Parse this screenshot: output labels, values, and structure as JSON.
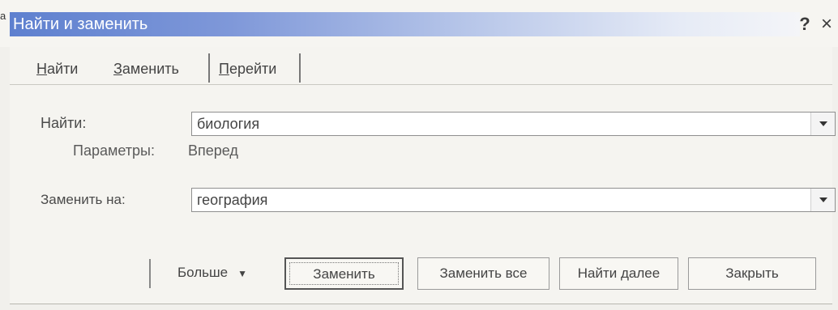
{
  "window": {
    "title": "Найти и заменить",
    "corner_mark": "a",
    "help_glyph": "?",
    "close_glyph": "×"
  },
  "tabs": [
    {
      "label_pre": "",
      "label_key": "Н",
      "label_post": "айти"
    },
    {
      "label_pre": "",
      "label_key": "З",
      "label_post": "аменить"
    },
    {
      "label_pre": "",
      "label_key": "П",
      "label_post": "ерейти"
    }
  ],
  "find": {
    "label": "Найти:",
    "value": "биология",
    "params_label": "Параметры:",
    "params_value": "Вперед"
  },
  "replace": {
    "label": "Заменить на:",
    "value": "география"
  },
  "buttons": {
    "more": "Больше",
    "more_arrow": "▼",
    "replace": "Заменить",
    "replace_all": "Заменить все",
    "find_next": "Найти далее",
    "close": "Закрыть"
  },
  "colors": {
    "title_start": "#5e80cf",
    "title_end": "#f4f5f8",
    "panel_bg": "#f5f4f0"
  }
}
